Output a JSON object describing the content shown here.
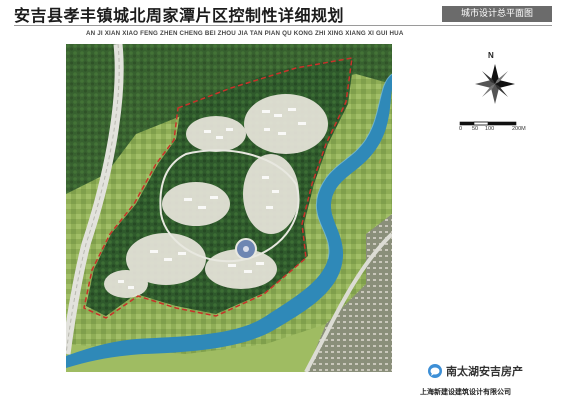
{
  "header": {
    "title": "安吉县孝丰镇城北周家潭片区控制性详细规划",
    "subtitle_pinyin": "AN JI XIAN XIAO FENG ZHEN CHENG BEI ZHOU JIA TAN PIAN QU KONG ZHI XING XIANG XI GUI HUA",
    "sheet_name": "城市设计总平面图"
  },
  "legend": {
    "north_label": "N",
    "scale_ticks": [
      "0",
      "50",
      "100",
      "200M"
    ]
  },
  "watermark": {
    "text": "南太湖安吉房产",
    "icon": "chat-bubble-icon"
  },
  "footer": {
    "company": "上海新建设建筑设计有限公司"
  },
  "colors": {
    "river": "#2f89b8",
    "boundary": "#c8322a",
    "forest": "#2f5a2c",
    "field": "#9dbb5f",
    "road": "#d8d8d2"
  }
}
